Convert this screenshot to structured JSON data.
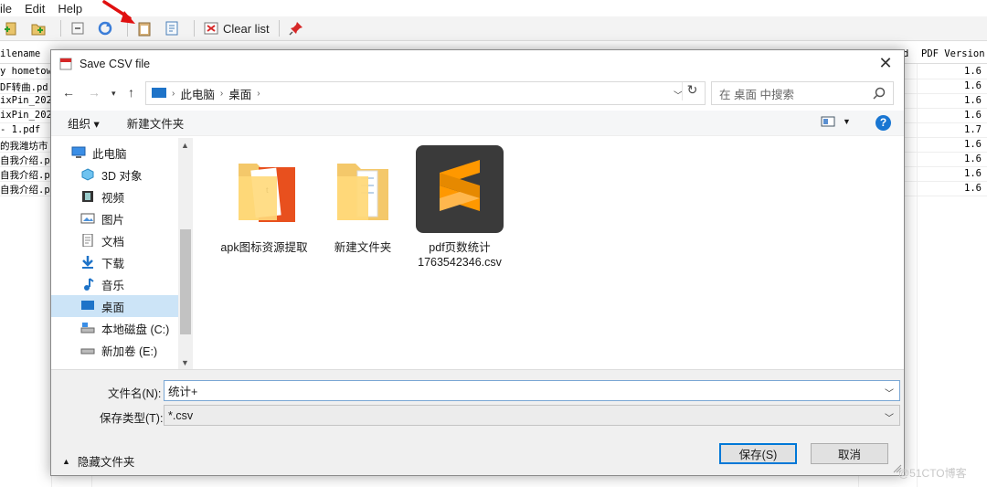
{
  "menu": {
    "file": "ile",
    "edit": "Edit",
    "help": "Help"
  },
  "toolbar": {
    "clear_label": "Clear list"
  },
  "grid": {
    "col_filename": "ilename",
    "col_d": "d",
    "col_pdf_version": "PDF Version",
    "rows": [
      {
        "name": "y hometow",
        "ver": "1.6"
      },
      {
        "name": "DF转曲.pd",
        "ver": "1.6"
      },
      {
        "name": "ixPin_202",
        "ver": "1.6"
      },
      {
        "name": "ixPin_202",
        "ver": "1.6"
      },
      {
        "name": "- 1.pdf",
        "ver": "1.7"
      },
      {
        "name": "的我潍坊市",
        "ver": "1.6"
      },
      {
        "name": "自我介绍.p",
        "ver": "1.6"
      },
      {
        "name": "自我介绍.p",
        "ver": "1.6"
      },
      {
        "name": "自我介绍.p",
        "ver": "1.6"
      }
    ]
  },
  "dialog": {
    "title": "Save CSV file",
    "breadcrumb": [
      "此电脑",
      "桌面"
    ],
    "search_placeholder": "在 桌面 中搜索",
    "organize": "组织 ▾",
    "new_folder": "新建文件夹",
    "tree": [
      {
        "label": "此电脑",
        "icon": "pc-icon"
      },
      {
        "label": "3D 对象",
        "icon": "cube-icon"
      },
      {
        "label": "视频",
        "icon": "video-icon"
      },
      {
        "label": "图片",
        "icon": "picture-icon"
      },
      {
        "label": "文档",
        "icon": "document-icon"
      },
      {
        "label": "下载",
        "icon": "download-icon"
      },
      {
        "label": "音乐",
        "icon": "music-icon"
      },
      {
        "label": "桌面",
        "icon": "desktop-icon",
        "selected": true
      },
      {
        "label": "本地磁盘 (C:)",
        "icon": "drive-icon"
      },
      {
        "label": "新加卷 (E:)",
        "icon": "drive-icon"
      }
    ],
    "files": [
      {
        "label": "apk图标资源提取",
        "type": "folder-with-image"
      },
      {
        "label": "新建文件夹",
        "type": "folder"
      },
      {
        "label": "pdf页数统计1763542346.csv",
        "type": "sublime-file"
      }
    ],
    "filename_label": "文件名(N):",
    "filename_value": "统计+",
    "filetype_label": "保存类型(T):",
    "filetype_value": "*.csv",
    "hide_folders": "隐藏文件夹",
    "save": "保存(S)",
    "cancel": "取消"
  },
  "watermark": "@51CTO博客",
  "colors": {
    "accent": "#0078d7",
    "selection": "#cce4f7",
    "help": "#1976d2"
  }
}
